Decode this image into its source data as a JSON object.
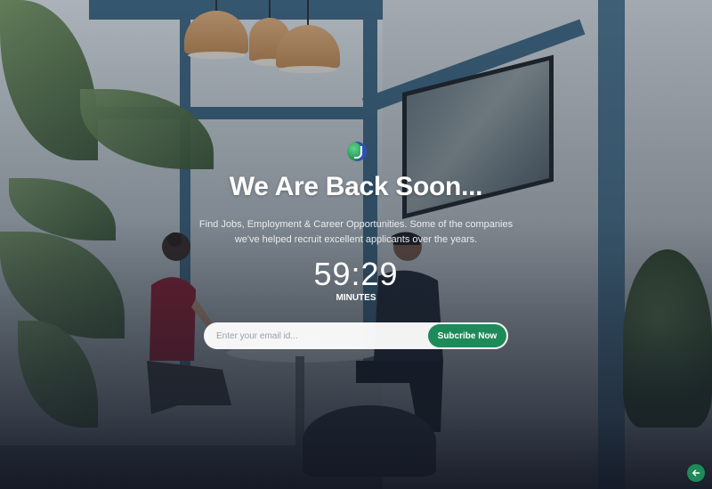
{
  "page": {
    "headline": "We Are Back Soon...",
    "subtitle": "Find Jobs, Employment & Career Opportunities. Some of the companies we've helped recruit excellent applicants over the years.",
    "logo_icon": "brand-logo-icon"
  },
  "countdown": {
    "value": "59:29",
    "unit": "MINUTES"
  },
  "subscribe": {
    "email_placeholder": "Enter your email id...",
    "email_value": "",
    "button_label": "Subcribe Now"
  },
  "back_to_top": {
    "icon": "arrow-left-icon"
  },
  "colors": {
    "accent": "#1e8a5a",
    "text": "#ffffff",
    "overlay": "#182230"
  }
}
